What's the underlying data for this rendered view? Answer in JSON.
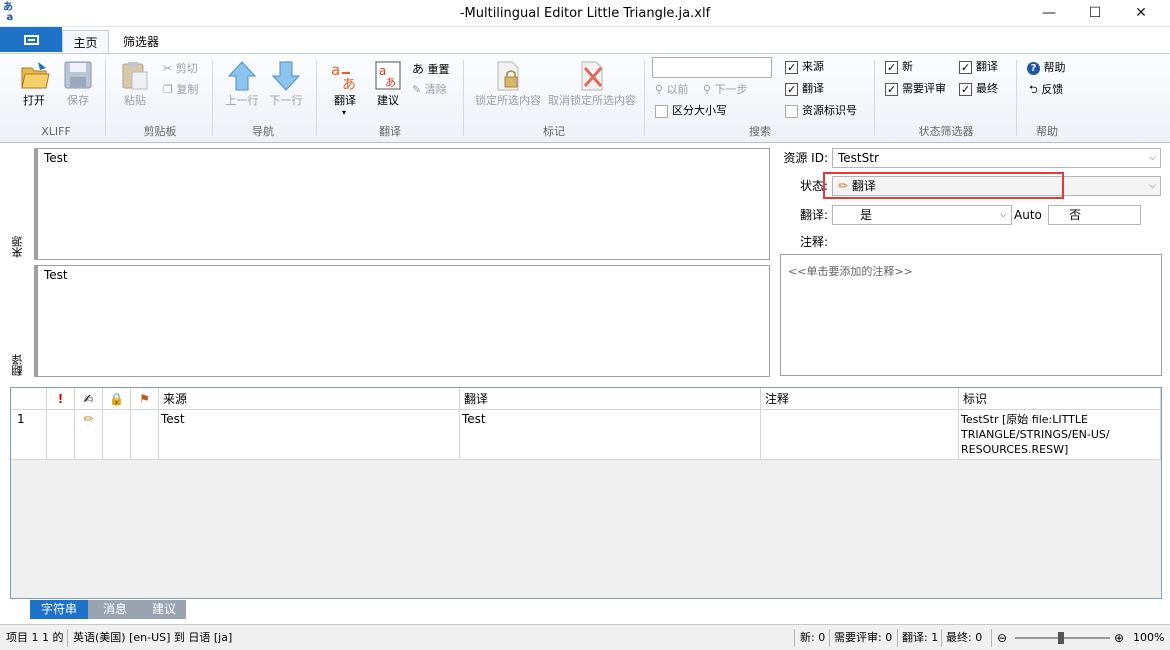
{
  "window": {
    "title": "-Multilingual Editor Little Triangle.ja.xlf",
    "minimize": "—",
    "maximize": "☐",
    "close": "✕"
  },
  "ribbon_tabs": [
    "主页",
    "筛选器"
  ],
  "ribbon": {
    "xliff": {
      "label": "XLIFF",
      "open": "打开",
      "save": "保存"
    },
    "clipboard": {
      "label": "剪贴板",
      "paste": "粘贴",
      "cut": "剪切",
      "copy": "复制"
    },
    "nav": {
      "label": "导航",
      "prev": "上一行",
      "next": "下一行"
    },
    "translate": {
      "label": "翻译",
      "translate": "翻译",
      "suggest": "建议",
      "reset": "重置",
      "clear": "清除"
    },
    "mark": {
      "label": "标记",
      "lock": "锁定所选内容",
      "unlock": "取消锁定所选内容"
    },
    "search": {
      "label": "搜索",
      "query": "",
      "prev": "以前",
      "next": "下一步",
      "match_case": "区分大小写",
      "source": "来源",
      "translation": "翻译",
      "resource_id": "资源标识号"
    },
    "state_filter": {
      "label": "状态筛选器",
      "new": "新",
      "needs_review": "需要评审",
      "translated": "翻译",
      "final": "最终"
    },
    "help": {
      "label": "帮助",
      "help": "帮助",
      "feedback": "反馈"
    }
  },
  "editor": {
    "source_label": "来源",
    "target_label": "翻译",
    "source_text": "Test",
    "target_text": "Test",
    "resource_id_label": "资源 ID:",
    "resource_id_value": "TestStr",
    "state_label": "状态:",
    "state_value": "翻译",
    "translate_label": "翻译:",
    "translate_value": "是",
    "auto_label": "Auto",
    "auto_value": "否",
    "comment_label": "注释:",
    "comment_placeholder": "<<单击要添加的注释>>"
  },
  "grid": {
    "headers": {
      "index": "",
      "alert": "!",
      "source": "来源",
      "translation": "翻译",
      "comment": "注释",
      "id": "标识"
    },
    "rows": [
      {
        "index": "1",
        "source": "Test",
        "translation": "Test",
        "comment": "",
        "id": "TestStr [原始 file:LITTLE TRIANGLE/STRINGS/EN-US/ RESOURCES.RESW]"
      }
    ]
  },
  "bottom_tabs": [
    "字符串",
    "消息",
    "建议"
  ],
  "statusbar": {
    "items": "项目 1 1 的",
    "language": "英语(美国) [en-US] 到 日语 [ja]",
    "new": "新: 0",
    "needs_review": "需要评审: 0",
    "translated": "翻译: 1",
    "final": "最终: 0",
    "zoom": "100%"
  },
  "colors": {
    "accent": "#1e73c8",
    "highlight": "#e53935"
  }
}
